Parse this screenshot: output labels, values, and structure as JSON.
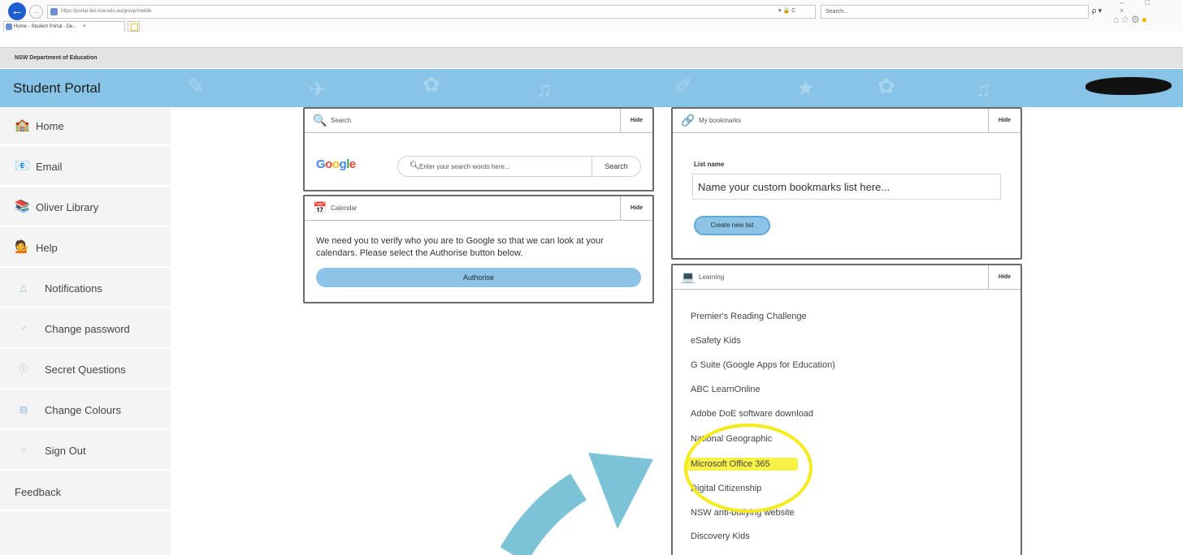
{
  "browser": {
    "url": "https://portal.det.nsw.edu.au/group/middle",
    "search_placeholder": "Search...",
    "tab_title": "Home - Student Portal - De...",
    "tab_close": "×",
    "back_glyph": "←",
    "forward_glyph": "→",
    "addr_tools": "▾ 🔒 C",
    "search_drop": "ρ ▾",
    "tool_glyphs": "⌂ ☆ ⚙",
    "win_controls": "– □ ×"
  },
  "header": {
    "department": "NSW Department of Education",
    "portal_title": "Student Portal"
  },
  "sidebar": {
    "items": [
      {
        "label": "Home",
        "icon": "🏫"
      },
      {
        "label": "Email",
        "icon": "📧"
      },
      {
        "label": "Oliver Library",
        "icon": "📚"
      },
      {
        "label": "Help",
        "icon": "💁"
      },
      {
        "label": "Notifications",
        "icon": "△"
      },
      {
        "label": "Change password",
        "icon": "♂"
      },
      {
        "label": "Secret Questions",
        "icon": "ⓘ"
      },
      {
        "label": "Change Colours",
        "icon": "▤"
      },
      {
        "label": "Sign Out",
        "icon": "○"
      }
    ],
    "feedback": "Feedback"
  },
  "search_panel": {
    "title": "Search",
    "hide": "Hide",
    "google_letters": [
      "G",
      "o",
      "o",
      "g",
      "l",
      "e"
    ],
    "placeholder": "Enter your search words here...",
    "button": "Search",
    "mag_glyph": "🔍"
  },
  "calendar_panel": {
    "title": "Calendar",
    "hide": "Hide",
    "message": "We need you to verify who you are to Google so that we can look at your calendars. Please select the Authorise button below.",
    "button": "Authorise",
    "icon": "📅"
  },
  "bookmarks_panel": {
    "title": "My bookmarks",
    "hide": "Hide",
    "list_label": "List name",
    "list_placeholder": "Name your custom bookmarks list here...",
    "create_button": "Create new list",
    "icon": "🔗"
  },
  "learning_panel": {
    "title": "Learning",
    "hide": "Hide",
    "icon": "💻",
    "links": [
      "Premier's Reading Challenge",
      "eSafety Kids",
      "G Suite (Google Apps for Education)",
      "ABC LearnOnline",
      "Adobe DoE software download",
      "National Geographic",
      "Microsoft Office 365",
      "Digital Citizenship",
      "NSW anti-bullying website",
      "Discovery Kids"
    ]
  },
  "annotation": {
    "highlight_color": "#f5ea1a",
    "arrow_color": "#7cc3d8",
    "highlighted_item": "Microsoft Office 365"
  }
}
